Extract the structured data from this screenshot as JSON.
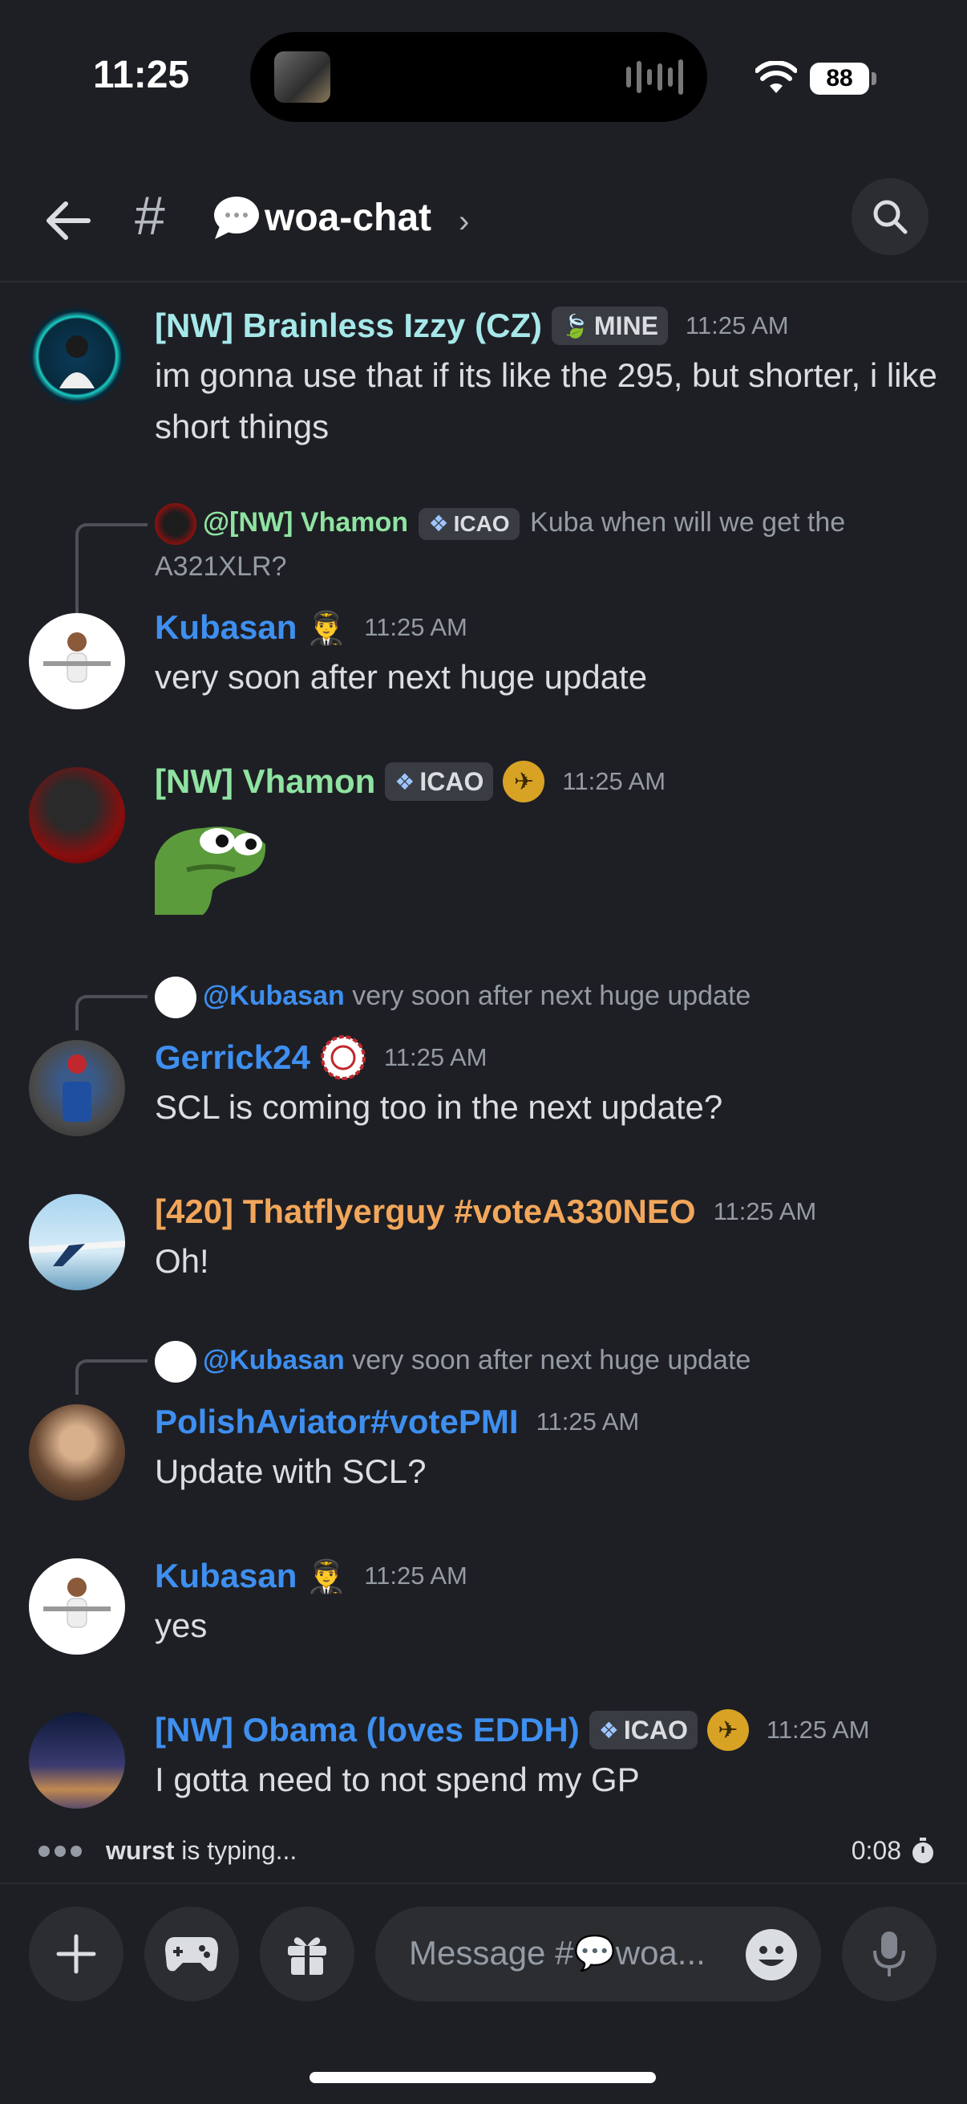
{
  "status_bar": {
    "time": "11:25",
    "battery": "88"
  },
  "header": {
    "channel_name": "woa-chat"
  },
  "messages": [
    {
      "author": "[NW] Brainless Izzy (CZ)",
      "tag": "MINE",
      "time": "11:25 AM",
      "text": "im gonna use that if its like the 295, but shorter, i like short things"
    },
    {
      "reply_author": "@[NW] Vhamon",
      "reply_tag": "ICAO",
      "reply_text": "Kuba when will we get the A321XLR?",
      "author": "Kubasan",
      "time": "11:25 AM",
      "text": "very soon after next huge update"
    },
    {
      "author": "[NW] Vhamon",
      "tag": "ICAO",
      "time": "11:25 AM"
    },
    {
      "reply_author": "@Kubasan",
      "reply_text": "very soon after next huge update",
      "author": "Gerrick24",
      "time": "11:25 AM",
      "text": "SCL is coming too in the next update?"
    },
    {
      "author": "[420] Thatflyerguy #voteA330NEO",
      "time": "11:25 AM",
      "text": "Oh!"
    },
    {
      "reply_author": "@Kubasan",
      "reply_text": "very soon after next huge update",
      "author": "PolishAviator#votePMI",
      "time": "11:25 AM",
      "text": "Update with SCL?"
    },
    {
      "author": "Kubasan",
      "time": "11:25 AM",
      "text": "yes"
    },
    {
      "author": "[NW] Obama (loves EDDH)",
      "tag": "ICAO",
      "time": "11:25 AM",
      "text": "I gotta need to not spend my GP"
    }
  ],
  "typing": {
    "user": "wurst",
    "suffix": " is typing...",
    "timer": "0:08"
  },
  "composer": {
    "placeholder": "Message #💬woa..."
  },
  "colors": {
    "background": "#1e1f24",
    "link_blue": "#3e8ff0",
    "teal": "#a6e8ea",
    "green": "#8fe3a1",
    "orange": "#f2a65a"
  }
}
